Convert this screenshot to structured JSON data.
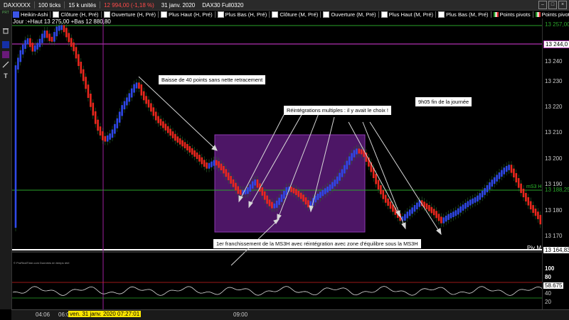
{
  "toolbar": {
    "instrument": "DAXXXXX",
    "ticks": "100 ticks",
    "units": "15 k unités",
    "price": "12 994,00 (-1,18 %)",
    "date": "31 janv. 2020",
    "product": "DAX30 Full0320",
    "win_min": "–",
    "win_max": "□",
    "win_close": "×"
  },
  "legend": {
    "items": [
      "Heikin-Ashi",
      "Clôture (H, Pré)",
      "Ouverture (H, Pré)",
      "Plus Haut (H, Pré)",
      "Plus Bas (H, Pré)",
      "Clôture (M, Pré)",
      "Ouverture (M, Pré)",
      "Plus Haut (M, Pré)",
      "Plus Bas (M, Pré)",
      "Points pivots",
      "Points pivots (M)"
    ]
  },
  "subinfo": "Jour :+Haut 13 275,00 +Bas 12 880,80",
  "y_axis": {
    "labels": [
      "13 240",
      "13 230",
      "13 220",
      "13 210",
      "13 200",
      "13 190",
      "13 180",
      "13 170"
    ],
    "tags": {
      "top": "13 257,00",
      "magenta": "13 244,0",
      "green": "13 188,25",
      "bottom": "13 164,83"
    },
    "osc_labels": [
      "100",
      "80",
      "58.675",
      "40",
      "20"
    ]
  },
  "x_axis": {
    "labels": [
      "04:06",
      "06:0",
      "09:00"
    ],
    "cursor_date": "ven. 31 janv. 2020 07:27:01"
  },
  "annotations": {
    "baisse": "Baisse de 40 points sans nette retracement",
    "reintegrations": "Réintégrations multiples : il y avait le choix !",
    "fin": "9h05 fin de la journée",
    "franchissement": "1er franchissement de la MS3H avec réintégration avec zone d'équilibre sous la MS3H"
  },
  "chart_labels": {
    "ms3h": "mS3 H",
    "pivot": "Piv M",
    "credit": "© ProRealTime.com Données en temps réel"
  },
  "colors": {
    "bull": "#2f48e6",
    "bear": "#e8281e",
    "magenta_line": "#a020a0",
    "green_line": "#2aa52a",
    "zone": "#6c1f8c"
  },
  "icons": {
    "trash": "trash-icon",
    "color_blue": "color-swatch-icon",
    "color_purple": "color-swatch-icon",
    "line_tool": "line-tool-icon",
    "text_tool": "text-tool-icon"
  }
}
